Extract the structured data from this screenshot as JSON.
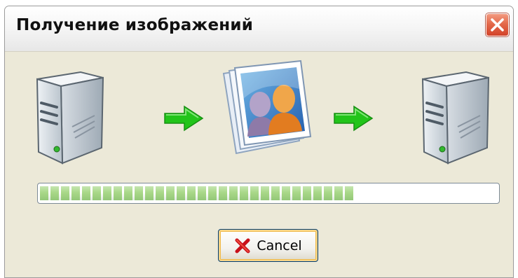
{
  "window": {
    "title": "Получение изображений"
  },
  "icons": {
    "close": "close-icon",
    "source": "server-icon",
    "destination": "server-icon",
    "transfer_arrow": "arrow-right-icon",
    "images": "photo-stack-icon",
    "cancel": "red-x-icon"
  },
  "progress": {
    "fraction": 0.685
  },
  "buttons": {
    "cancel_label": "Cancel"
  },
  "colors": {
    "progress_fill": "#a8d888",
    "arrow": "#22c41a",
    "close_button": "#d2432a",
    "dialog_bg": "#ece9d8"
  }
}
